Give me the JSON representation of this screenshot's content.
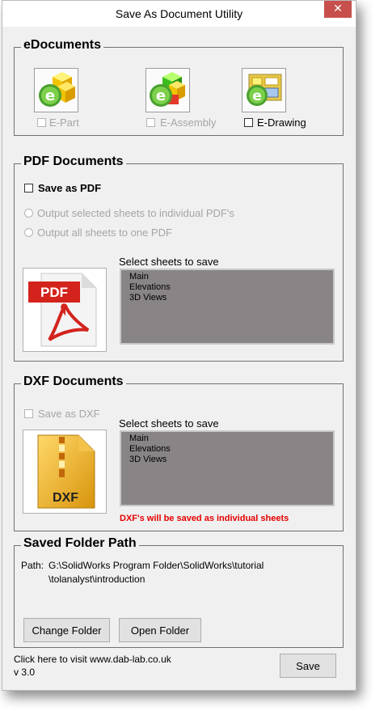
{
  "window": {
    "title": "Save As Document Utility",
    "close_symbol": "✕"
  },
  "edocuments": {
    "title": "eDocuments",
    "items": [
      {
        "label": "E-Part",
        "enabled": false,
        "icon": "e-part-icon"
      },
      {
        "label": "E-Assembly",
        "enabled": false,
        "icon": "e-assembly-icon"
      },
      {
        "label": "E-Drawing",
        "enabled": true,
        "icon": "e-drawing-icon"
      }
    ]
  },
  "pdf": {
    "title": "PDF Documents",
    "save_label": "Save as PDF",
    "radio1": "Output selected sheets to individual PDF's",
    "radio2": "Output all sheets to one PDF",
    "sheets_label": "Select sheets to save",
    "sheets": [
      "Main",
      "Elevations",
      "3D Views"
    ],
    "icon_text": "PDF"
  },
  "dxf": {
    "title": "DXF Documents",
    "save_label": "Save as DXF",
    "sheets_label": "Select sheets to save",
    "sheets": [
      "Main",
      "Elevations",
      "3D Views"
    ],
    "note": "DXF's will be saved as individual sheets",
    "icon_text": "DXF"
  },
  "folder": {
    "title": "Saved Folder Path",
    "path_label": "Path:",
    "path_line1": "G:\\SolidWorks Program Folder\\SolidWorks\\tutorial",
    "path_line2": "\\tolanalyst\\introduction",
    "change_button": "Change Folder",
    "open_button": "Open Folder"
  },
  "footer": {
    "link": "Click here to visit www.dab-lab.co.uk",
    "version": "v 3.0",
    "save_button": "Save"
  },
  "colors": {
    "listbox": "#898486",
    "note": "#e60000",
    "close": "#c7504c"
  }
}
